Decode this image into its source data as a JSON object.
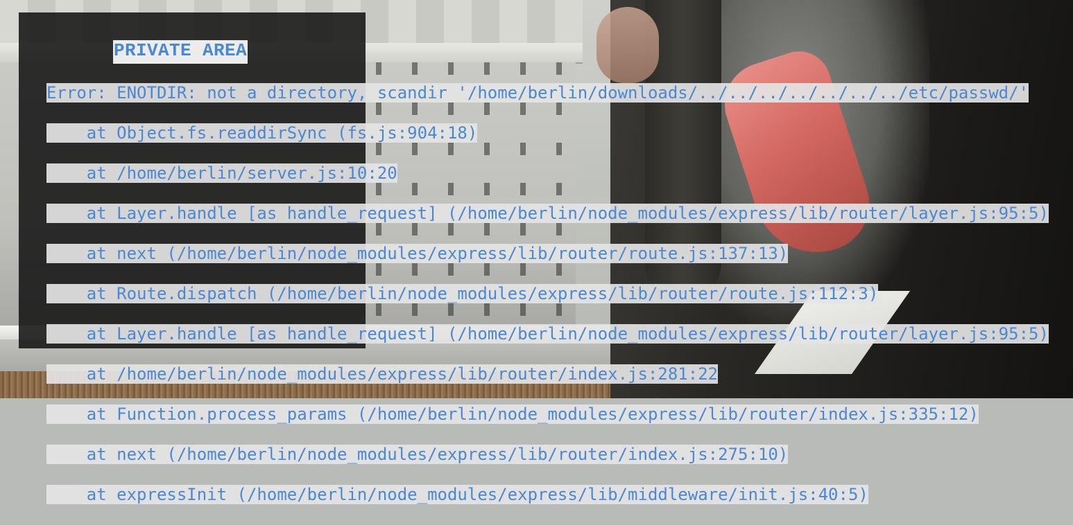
{
  "panel": {
    "title": "PRIVATE AREA"
  },
  "error": {
    "lines": [
      "Error: ENOTDIR: not a directory, scandir '/home/berlin/downloads/../../../../../../../etc/passwd/'",
      "    at Object.fs.readdirSync (fs.js:904:18)",
      "    at /home/berlin/server.js:10:20",
      "    at Layer.handle [as handle_request] (/home/berlin/node_modules/express/lib/router/layer.js:95:5)",
      "    at next (/home/berlin/node_modules/express/lib/router/route.js:137:13)",
      "    at Route.dispatch (/home/berlin/node_modules/express/lib/router/route.js:112:3)",
      "    at Layer.handle [as handle_request] (/home/berlin/node_modules/express/lib/router/layer.js:95:5)",
      "    at /home/berlin/node_modules/express/lib/router/index.js:281:22",
      "    at Function.process_params (/home/berlin/node_modules/express/lib/router/index.js:335:12)",
      "    at next (/home/berlin/node_modules/express/lib/router/index.js:275:10)",
      "    at expressInit (/home/berlin/node_modules/express/lib/middleware/init.js:40:5)"
    ]
  },
  "colors": {
    "text": "#4a88d2",
    "highlight": "#e4e4e4",
    "panel": "#141414"
  }
}
